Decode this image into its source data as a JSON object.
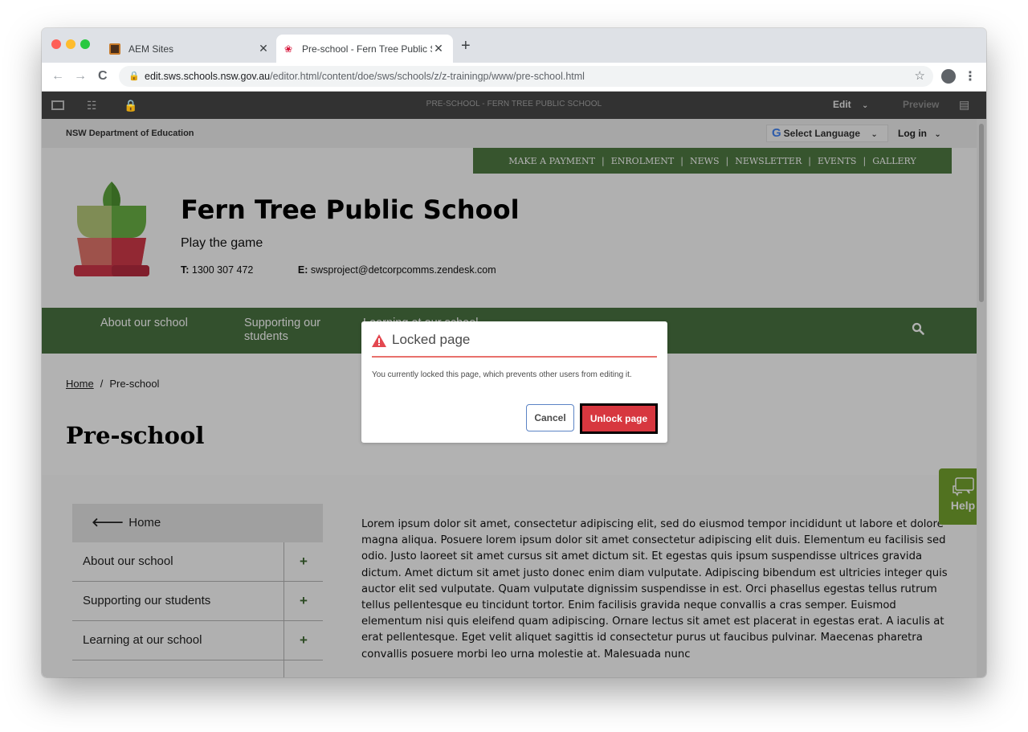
{
  "browser": {
    "tabs": [
      {
        "title": "AEM Sites",
        "favicon": "aem-icon",
        "active": false
      },
      {
        "title": "Pre-school - Fern Tree Public S",
        "favicon": "nsw-waratah-icon",
        "active": true
      }
    ],
    "url_host": "edit.sws.schools.nsw.gov.au",
    "url_path": "/editor.html/content/doe/sws/schools/z/z-trainingp/www/pre-school.html"
  },
  "aem": {
    "page_title": "PRE-SCHOOL - FERN TREE PUBLIC SCHOOL",
    "mode_label": "Edit",
    "preview_label": "Preview"
  },
  "site": {
    "department": "NSW Department of Education",
    "language_label": "Select Language",
    "login_label": "Log in",
    "quick_links": [
      "MAKE A PAYMENT",
      "ENROLMENT",
      "NEWS",
      "NEWSLETTER",
      "EVENTS",
      "GALLERY"
    ],
    "school_name": "Fern Tree Public School",
    "tagline": "Play the game",
    "phone_label": "T:",
    "phone": "1300 307 472",
    "email_label": "E:",
    "email": "swsproject@detcorpcomms.zendesk.com",
    "main_nav": [
      "About our school",
      "Supporting our students",
      "Learning at our school"
    ],
    "breadcrumb": {
      "home": "Home",
      "separator": "/",
      "current": "Pre-school"
    },
    "page_heading": "Pre-school",
    "side_nav": {
      "home_label": "Home",
      "items": [
        "About our school",
        "Supporting our students",
        "Learning at our school"
      ]
    },
    "body_text": "Lorem ipsum dolor sit amet, consectetur adipiscing elit, sed do eiusmod tempor incididunt ut labore et dolore magna aliqua. Posuere lorem ipsum dolor sit amet consectetur adipiscing elit duis. Elementum eu facilisis sed odio. Justo laoreet sit amet cursus sit amet dictum sit. Et egestas quis ipsum suspendisse ultrices gravida dictum. Amet dictum sit amet justo donec enim diam vulputate. Adipiscing bibendum est ultricies integer quis auctor elit sed vulputate. Quam vulputate dignissim suspendisse in est. Orci phasellus egestas tellus rutrum tellus pellentesque eu tincidunt tortor. Enim facilisis gravida neque convallis a cras semper. Euismod elementum nisi quis eleifend quam adipiscing. Ornare lectus sit amet est placerat in egestas erat. A iaculis at erat pellentesque. Eget velit aliquet sagittis id consectetur purus ut faucibus pulvinar. Maecenas pharetra convallis posuere morbi leo urna molestie at. Malesuada nunc",
    "help_label": "Help"
  },
  "dialog": {
    "title": "Locked page",
    "message": "You currently locked this page, which prevents other users from editing it.",
    "cancel_label": "Cancel",
    "confirm_label": "Unlock page"
  },
  "colors": {
    "brand_green": "#4a7341",
    "help_green": "#75a42e",
    "danger_red": "#d7373f"
  }
}
